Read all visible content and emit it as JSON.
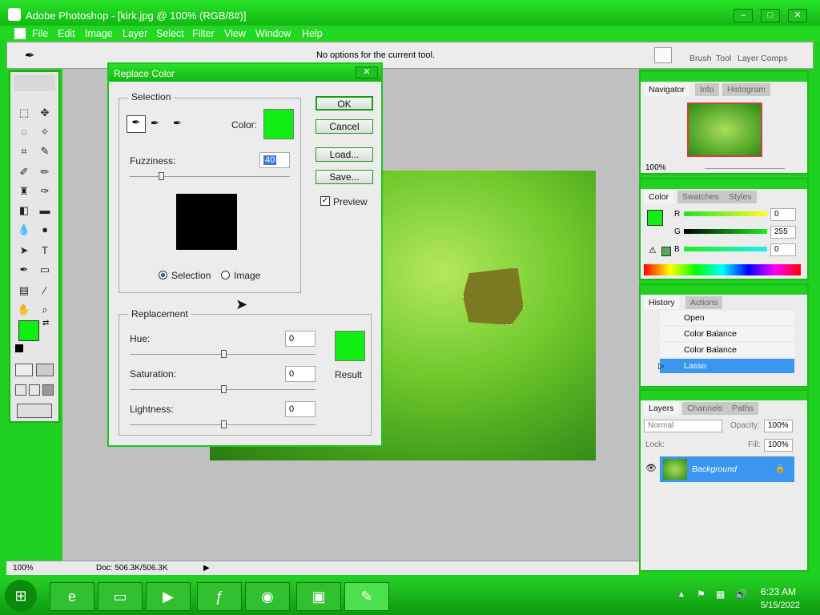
{
  "window": {
    "title": "Adobe Photoshop - [kirk.jpg @ 100% (RGB/8#)]"
  },
  "menu": [
    "File",
    "Edit",
    "Image",
    "Layer",
    "Select",
    "Filter",
    "View",
    "Window",
    "Help"
  ],
  "options": {
    "message": "No options for the current tool."
  },
  "palette_well": [
    "Brush",
    "Tool",
    "Layer Comps"
  ],
  "dialog": {
    "title": "Replace Color",
    "selection_label": "Selection",
    "color_label": "Color:",
    "fuzziness_label": "Fuzziness:",
    "fuzziness_value": "40",
    "radio_selection": "Selection",
    "radio_image": "Image",
    "replacement_label": "Replacement",
    "hue_label": "Hue:",
    "hue_value": "0",
    "saturation_label": "Saturation:",
    "saturation_value": "0",
    "lightness_label": "Lightness:",
    "lightness_value": "0",
    "result_label": "Result",
    "ok": "OK",
    "cancel": "Cancel",
    "load": "Load...",
    "save": "Save...",
    "preview": "Preview"
  },
  "navigator": {
    "tabs": [
      "Navigator",
      "Info",
      "Histogram"
    ],
    "zoom": "100%"
  },
  "color_panel": {
    "tabs": [
      "Color",
      "Swatches",
      "Styles"
    ],
    "r_label": "R",
    "g_label": "G",
    "b_label": "B",
    "r": "0",
    "g": "255",
    "b": "0"
  },
  "history": {
    "tabs": [
      "History",
      "Actions"
    ],
    "items": [
      "Open",
      "Color Balance",
      "Color Balance",
      "Lasso"
    ]
  },
  "layers": {
    "tabs": [
      "Layers",
      "Channels",
      "Paths"
    ],
    "blend": "Normal",
    "opacity_label": "Opacity:",
    "opacity": "100%",
    "lock_label": "Lock:",
    "fill_label": "Fill:",
    "fill": "100%",
    "layer_name": "Background"
  },
  "status": {
    "zoom": "100%",
    "doc": "Doc: 506.3K/506.3K"
  },
  "clock": {
    "time": "6:23 AM",
    "date": "5/15/2022"
  },
  "colors": {
    "accent": "#22d822",
    "swatch": "#11ee11"
  }
}
